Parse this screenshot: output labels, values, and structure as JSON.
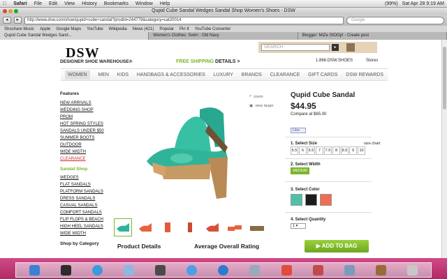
{
  "os_menubar": {
    "apple": "",
    "app": "Safari",
    "items": [
      "File",
      "Edit",
      "View",
      "History",
      "Bookmarks",
      "Window",
      "Help"
    ],
    "status": {
      "battery": "(99%)",
      "datetime": "Sat Apr 28  9:19 AM"
    }
  },
  "window": {
    "title": "Qupid Cube Sandal Wedges Sandal Shop Women's Shoes - DSW"
  },
  "toolbar": {
    "back": "◂",
    "forward": "▸",
    "url": "http://www.dsw.com/shoe/qupid+cube+sandal?prodId=244779&category=cat20014",
    "search_placeholder": "Google"
  },
  "bookmarks": [
    "Shoshare Music",
    "Apple",
    "Google Maps",
    "YouTube",
    "Wikipedia",
    "News (421)",
    "Popular",
    "Pin It",
    "YouTube Converter"
  ],
  "tabs": [
    {
      "label": "Qupid Cube Sandal Wedges Sand...",
      "active": true
    },
    {
      "label": "Women's Clothes: Swim : Old Navy",
      "active": false
    },
    {
      "label": "Blogger: MiZe StOOp! - Create post",
      "active": false
    }
  ],
  "header": {
    "logo": "DSW",
    "logo_sub": "DESIGNER SHOE WAREHOUSE®",
    "free_shipping": "FREE SHIPPING",
    "details": "DETAILS >",
    "search_placeholder": "SEARCH",
    "phone": "1.866.DSW.SHOES",
    "stores": "Stores"
  },
  "nav": [
    "WOMEN",
    "MEN",
    "KIDS",
    "HANDBAGS & ACCESSORIES",
    "LUXURY",
    "BRANDS",
    "CLEARANCE",
    "GIFT CARDS",
    "DSW REWARDS"
  ],
  "left": {
    "features_title": "Features",
    "features": [
      "NEW ARRIVALS",
      "WEDDING SHOP",
      "PROM",
      "HOT SPRING STYLES",
      "SANDALS UNDER $50",
      "SUMMER BOOTS",
      "OUTDOOR",
      "WIDE WIDTH",
      "CLEARANCE"
    ],
    "sandal_title": "Sandal Shop",
    "sandals": [
      "WEDGES",
      "FLAT SANDALS",
      "PLATFORM SANDALS",
      "DRESS SANDALS",
      "CASUAL SANDALS",
      "COMFORT SANDALS",
      "FLIP FLOPS & BEACH",
      "HIGH HEEL SANDALS",
      "WIDE WIDTH"
    ],
    "category_title": "Shop by Category"
  },
  "product": {
    "zoom": "zoom",
    "view_larger": "view larger",
    "name": "Qupid Cube Sandal",
    "price": "$44.95",
    "compare": "Compare at $65.00",
    "like": "Like",
    "details_title": "Product Details",
    "rating_title": "Average Overall Rating",
    "size_label": "1. Select Size",
    "size_chart": "size chart",
    "sizes": [
      "5.5",
      "6",
      "6.5",
      "7",
      "7.5",
      "8",
      "8.5",
      "9",
      "10"
    ],
    "width_label": "2. Select Width",
    "width_value": "MEDIUM",
    "color_label": "3. Select Color",
    "colors": [
      "#4fc1a6",
      "#1c1c1c",
      "#ef6c55"
    ],
    "qty_label": "4. Select Quantity",
    "qty_value": "1",
    "add_to_bag": "ADD TO BAG"
  },
  "dock": [
    "finder-icon",
    "dashboard-icon",
    "safari-icon",
    "mail-icon",
    "facetime-icon",
    "itunes-icon",
    "app-store-icon",
    "preview-icon",
    "ical-icon",
    "photo-booth-icon",
    "iphoto-icon",
    "garageband-icon",
    "trash-icon"
  ]
}
